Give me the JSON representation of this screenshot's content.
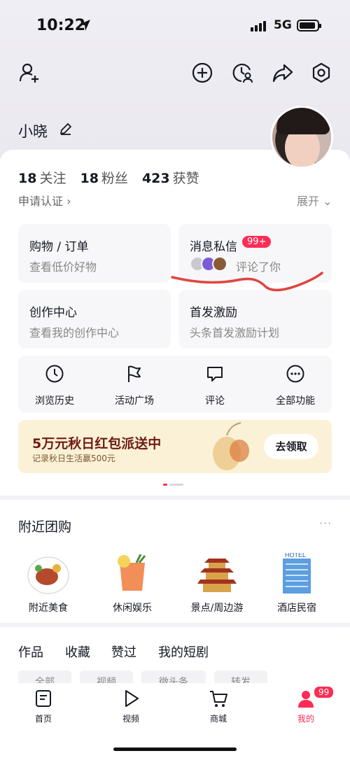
{
  "status": {
    "time": "10:22",
    "network": "5G"
  },
  "profile": {
    "username": "小晓"
  },
  "stats": [
    {
      "num": "18",
      "label": "关注"
    },
    {
      "num": "18",
      "label": "粉丝"
    },
    {
      "num": "423",
      "label": "获赞"
    }
  ],
  "cert_label": "申请认证",
  "expand_label": "展开",
  "cards": {
    "shopping": {
      "title": "购物 / 订单",
      "sub": "查看低价好物"
    },
    "messages": {
      "title": "消息私信",
      "badge": "99+",
      "sub": "评论了你"
    },
    "creator": {
      "title": "创作中心",
      "sub": "查看我的创作中心"
    },
    "incentive": {
      "title": "首发激励",
      "sub": "头条首发激励计划"
    }
  },
  "shortcuts": [
    {
      "label": "浏览历史",
      "icon": "clock-icon"
    },
    {
      "label": "活动广场",
      "icon": "flag-icon"
    },
    {
      "label": "评论",
      "icon": "comment-icon"
    },
    {
      "label": "全部功能",
      "icon": "more-icon"
    }
  ],
  "banner": {
    "title": "5万元秋日红包派送中",
    "sub": "记录秋日生活赢500元",
    "button": "去领取"
  },
  "group_buy": {
    "title": "附近团购",
    "more": "···",
    "items": [
      {
        "label": "附近美食",
        "icon": "food-icon"
      },
      {
        "label": "休闲娱乐",
        "icon": "drink-icon"
      },
      {
        "label": "景点/周边游",
        "icon": "pavilion-icon"
      },
      {
        "label": "酒店民宿",
        "icon": "hotel-icon"
      }
    ]
  },
  "content_tabs": [
    "作品",
    "收藏",
    "赞过",
    "我的短剧"
  ],
  "filters": [
    "全部",
    "视频",
    "微头条",
    "转发"
  ],
  "bottom_nav": [
    {
      "label": "首页",
      "icon": "home-icon"
    },
    {
      "label": "视频",
      "icon": "video-icon"
    },
    {
      "label": "商城",
      "icon": "cart-icon"
    },
    {
      "label": "我的",
      "icon": "me-icon"
    }
  ],
  "nav_badge": "99",
  "colors": {
    "accent": "#fe2c55",
    "banner_bg": "#fbf1d7",
    "banner_title": "#6e1c12"
  }
}
